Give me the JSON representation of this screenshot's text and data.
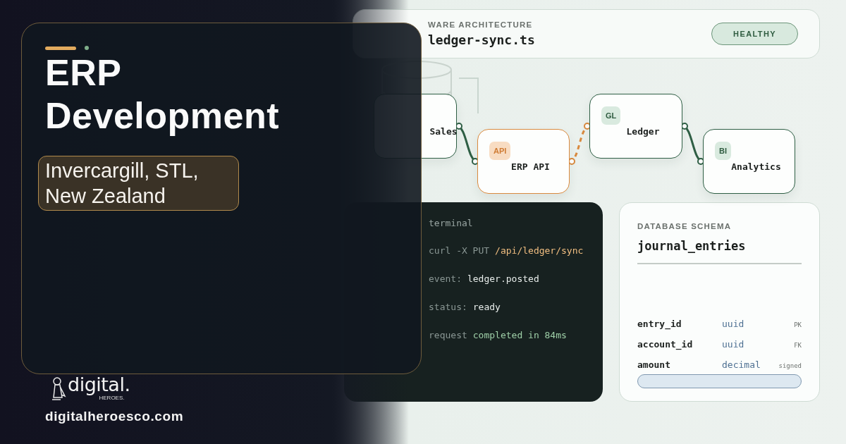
{
  "hero": {
    "title": "ERP Development",
    "location": "Invercargill, STL, New Zealand"
  },
  "brand": {
    "logo_word": "digital.",
    "logo_sub": "HEROES.",
    "website": "digitalheroesco.com"
  },
  "header_card": {
    "label": "WARE ARCHITECTURE",
    "file": "ledger-sync.ts",
    "status": "HEALTHY"
  },
  "nodes": [
    {
      "label": "Sales",
      "kind": "default"
    },
    {
      "label": "ERP API",
      "badge": "API",
      "kind": "accent"
    },
    {
      "label": "Ledger",
      "badge": "GL",
      "kind": "default"
    },
    {
      "label": "Analytics",
      "badge": "BI",
      "kind": "default"
    }
  ],
  "connectors": [
    {
      "kind": "solid"
    },
    {
      "kind": "dashed"
    },
    {
      "kind": "solid"
    }
  ],
  "terminal": {
    "title": "terminal",
    "lines": [
      {
        "prefix": "curl -X PUT",
        "value": "/api/ledger/sync",
        "kind": "command"
      },
      {
        "prefix": "event:",
        "value": "ledger.posted",
        "kind": "info"
      },
      {
        "prefix": "status:",
        "value": "ready",
        "kind": "info"
      },
      {
        "prefix": "request",
        "value": "completed in 84ms",
        "kind": "success"
      }
    ]
  },
  "schema": {
    "label": "DATABASE SCHEMA",
    "table": "journal_entries",
    "rows": [
      {
        "name": "entry_id",
        "type": "uuid",
        "tag": "PK"
      },
      {
        "name": "account_id",
        "type": "uuid",
        "tag": "FK"
      },
      {
        "name": "amount",
        "type": "decimal",
        "tag": "signed"
      }
    ]
  }
}
